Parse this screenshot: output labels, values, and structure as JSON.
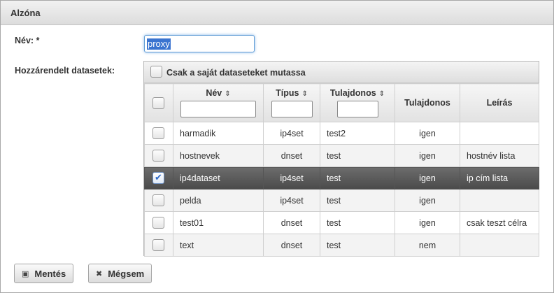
{
  "dialog": {
    "title": "Alzóna",
    "name_label": "Név: *",
    "name_value": "proxy",
    "datasets_label": "Hozzárendelt datasetek:",
    "own_only_label": "Csak a saját dataseteket mutassa"
  },
  "table": {
    "headers": {
      "name": "Név",
      "type": "Típus",
      "owner_filter": "Tulajdonos",
      "owner": "Tulajdonos",
      "description": "Leírás"
    },
    "rows": [
      {
        "name": "harmadik",
        "type": "ip4set",
        "owner": "test2",
        "own": "igen",
        "desc": "",
        "checked": false
      },
      {
        "name": "hostnevek",
        "type": "dnset",
        "owner": "test",
        "own": "igen",
        "desc": "hostnév lista",
        "checked": false
      },
      {
        "name": "ip4dataset",
        "type": "ip4set",
        "owner": "test",
        "own": "igen",
        "desc": "ip cím lista",
        "checked": true
      },
      {
        "name": "pelda",
        "type": "ip4set",
        "owner": "test",
        "own": "igen",
        "desc": "",
        "checked": false
      },
      {
        "name": "test01",
        "type": "dnset",
        "owner": "test",
        "own": "igen",
        "desc": "csak teszt célra",
        "checked": false
      },
      {
        "name": "text",
        "type": "dnset",
        "owner": "test",
        "own": "nem",
        "desc": "",
        "checked": false
      }
    ]
  },
  "buttons": {
    "save": "Mentés",
    "cancel": "Mégsem"
  },
  "icons": {
    "save": "floppy-icon",
    "cancel": "close-icon",
    "sort": "sort-icon"
  }
}
